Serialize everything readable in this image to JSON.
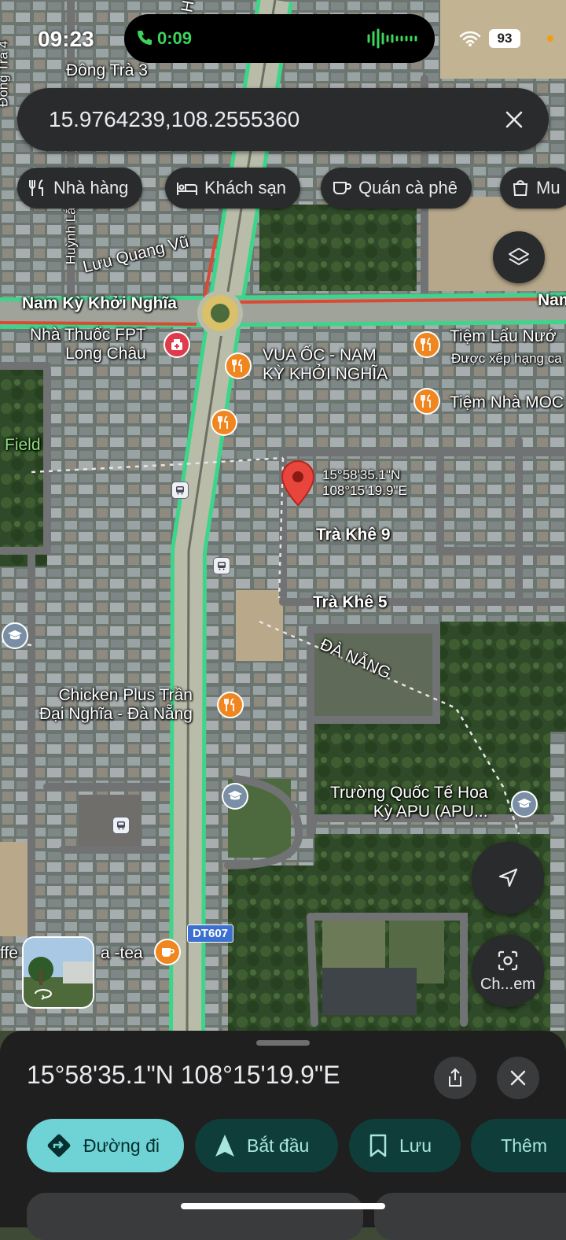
{
  "status_bar": {
    "time": "09:23",
    "call_duration": "0:09",
    "battery": "93"
  },
  "search": {
    "query": "15.9764239,108.2555360"
  },
  "chips": [
    {
      "label": "Nhà hàng",
      "icon": "fork-knife-icon"
    },
    {
      "label": "Khách sạn",
      "icon": "bed-icon"
    },
    {
      "label": "Quán cà phê",
      "icon": "coffee-cup-icon"
    },
    {
      "label": "Mu",
      "icon": "shopping-bag-icon"
    }
  ],
  "map": {
    "streets": {
      "dong_tra_3": "Đông Trà 3",
      "dong_tra_4": "Đông Trà 4",
      "huynh_la": "Huỳnh Lắ",
      "luu_quang_vu": "Lưu Quang Vũ",
      "nam_ky": "Nam Kỳ Khởi Nghĩa",
      "nam_right": "Nam",
      "tra_khe_9": "Trà Khê 9",
      "tra_khe_5": "Trà Khê 5",
      "da_nang": "ĐÀ NẴNG",
      "dt607": "DT607",
      "field": "Field",
      "h_top": "H"
    },
    "places": {
      "pharmacy_1": "Nhà Thuốc FPT",
      "pharmacy_2": "Long Châu",
      "vua_oc_1": "VUA ỐC - NAM",
      "vua_oc_2": "KỲ KHỞI NGHĨA",
      "tiem_lau": "Tiệm Lẩu Nướ",
      "tiem_lau_sub": "Được xếp hạng ca",
      "tiem_nha_moc": "Tiệm Nhà MOC",
      "chicken_1": "Chicken Plus Trần",
      "chicken_2": "Đại Nghĩa - Đà Nẵng",
      "school_1": "Trường Quốc Tế Hoa",
      "school_2": "Kỳ APU (APU...",
      "coffee_left": "ffe",
      "coffee_right": "a -tea"
    },
    "pin_label_lat": "15°58'35.1\"N",
    "pin_label_lng": "108°15'19.9\"E",
    "camera_label": "Ch...em"
  },
  "sheet": {
    "coordinates": "15°58'35.1\"N 108°15'19.9\"E",
    "actions": [
      {
        "label": "Đường đi",
        "icon": "directions-icon"
      },
      {
        "label": "Bắt đầu",
        "icon": "navigation-arrow-icon"
      },
      {
        "label": "Lưu",
        "icon": "bookmark-icon"
      },
      {
        "label": "Thêm",
        "icon": "flag-icon"
      }
    ]
  }
}
